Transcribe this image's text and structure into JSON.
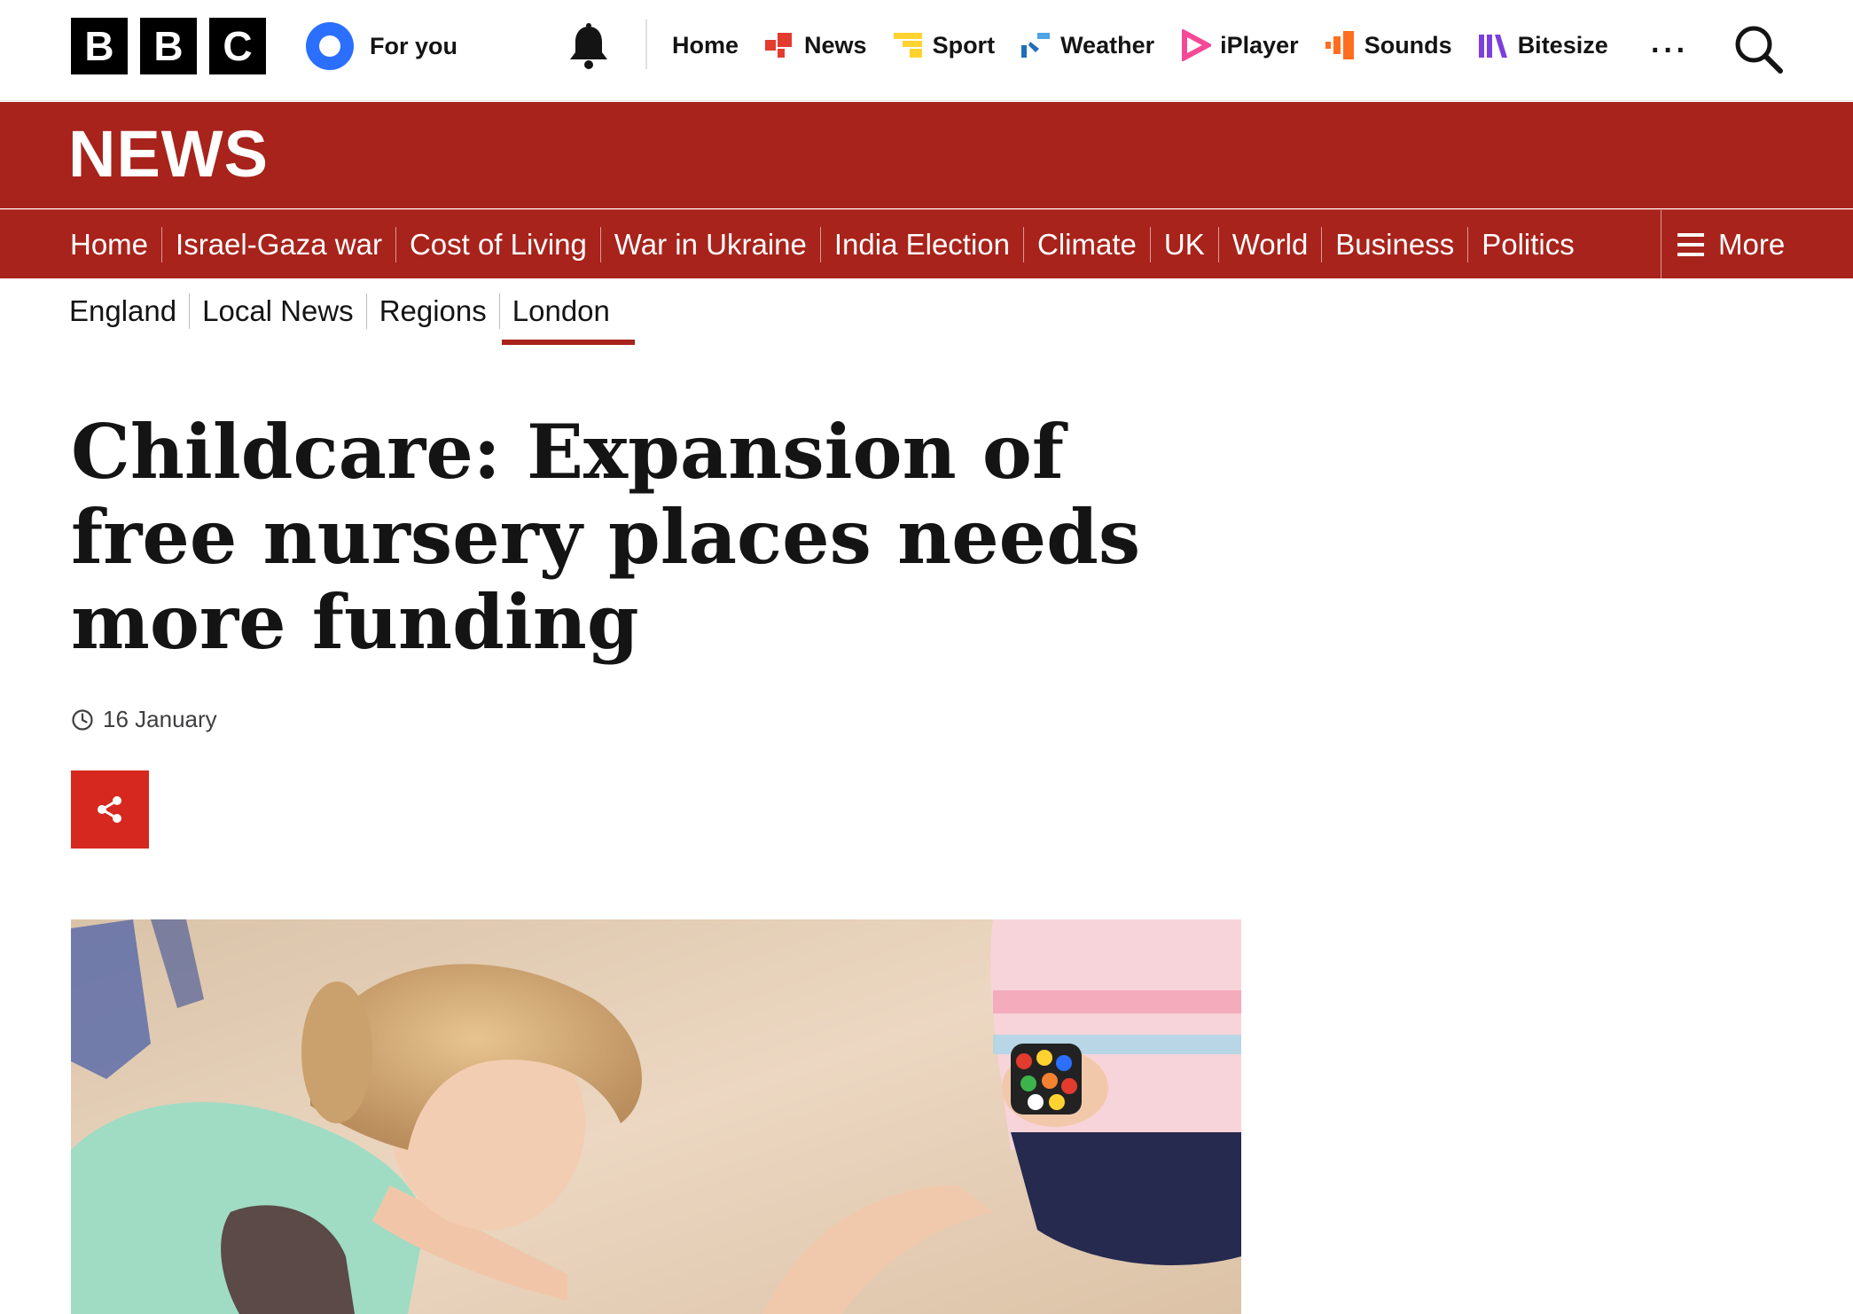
{
  "global_nav": {
    "logo_letters": [
      "B",
      "B",
      "C"
    ],
    "for_you": "For you",
    "services": [
      {
        "label": "Home",
        "icon": "none"
      },
      {
        "label": "News",
        "icon": "news-icon",
        "color": "#e33b2e"
      },
      {
        "label": "Sport",
        "icon": "sport-icon",
        "color": "#ffd230"
      },
      {
        "label": "Weather",
        "icon": "weather-icon",
        "color": "#1f6fb8"
      },
      {
        "label": "iPlayer",
        "icon": "iplayer-icon",
        "color": "#f54997"
      },
      {
        "label": "Sounds",
        "icon": "sounds-icon",
        "color": "#ff6d20"
      },
      {
        "label": "Bitesize",
        "icon": "bitesize-icon",
        "color": "#7b3fe0"
      }
    ],
    "more_label": "···"
  },
  "news_band": {
    "wordmark": "NEWS",
    "color": "#a8231b"
  },
  "section_nav": {
    "items": [
      "Home",
      "Israel-Gaza war",
      "Cost of Living",
      "War in Ukraine",
      "India Election",
      "Climate",
      "UK",
      "World",
      "Business",
      "Politics"
    ],
    "active": "UK",
    "more_label": "More"
  },
  "sub_nav": {
    "items": [
      "England",
      "Local News",
      "Regions",
      "London"
    ],
    "active": "London"
  },
  "article": {
    "headline": "Childcare: Expansion of free nursery places needs more funding",
    "date": "16 January",
    "share_color": "#d6281f",
    "hero_alt": ""
  }
}
